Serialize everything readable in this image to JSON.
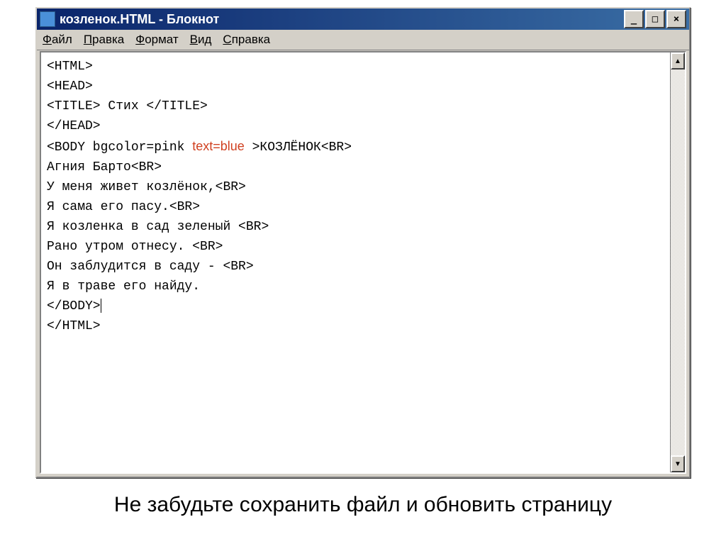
{
  "window": {
    "title": "козленок.HTML - Блокнот",
    "controls": {
      "min": "_",
      "max": "□",
      "close": "×"
    }
  },
  "menubar": {
    "file": "Файл",
    "edit": "Правка",
    "format": "Формат",
    "view": "Вид",
    "help": "Справка"
  },
  "editor": {
    "lines": [
      "<HTML>",
      "<HEAD>",
      "<TITLE> Стих </TITLE>",
      "</HEAD>",
      "<BODY bgcolor=pink ",
      " >КОЗЛЁНОК<BR>",
      "Агния Барто<BR>",
      "У меня живет козлёнок,<BR>",
      "Я сама его пасу.<BR>",
      "Я козленка в сад зеленый <BR>",
      "Рано утром отнесу. <BR>",
      "Он заблудится в саду - <BR>",
      "Я в траве его найду.",
      "</BODY>",
      "</HTML>"
    ],
    "annotation": "text=blue"
  },
  "scroll": {
    "up": "▲",
    "down": "▼"
  },
  "caption": "Не забудьте сохранить файл и обновить страницу"
}
